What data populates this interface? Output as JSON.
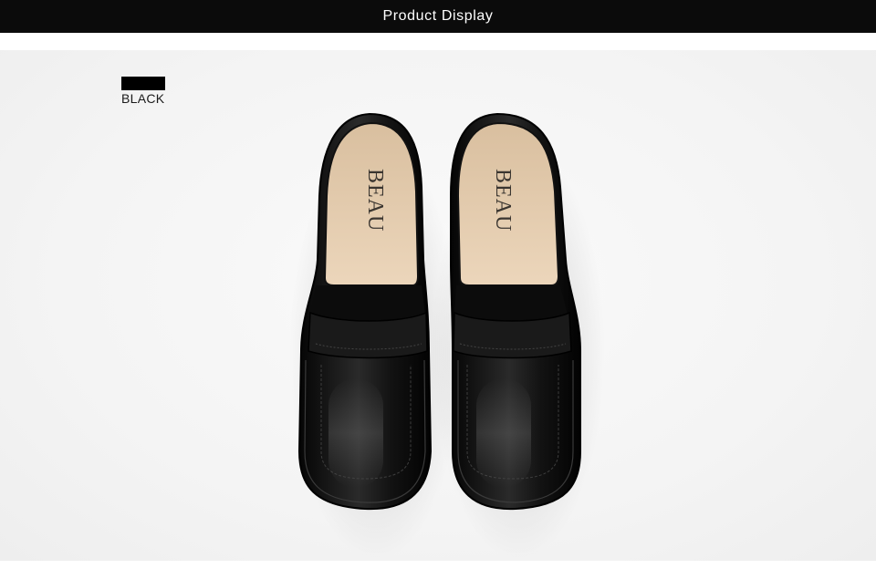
{
  "header": {
    "title": "Product Display"
  },
  "color_option": {
    "label": "BLACK",
    "swatch_color": "#000000"
  },
  "product": {
    "insole_brand": "BEAU",
    "shoe_color": "#111111",
    "insole_color": "#e2c9ab"
  },
  "colors": {
    "header_bg": "#0b0b0b",
    "stage_bg": "#f4f4f4"
  }
}
